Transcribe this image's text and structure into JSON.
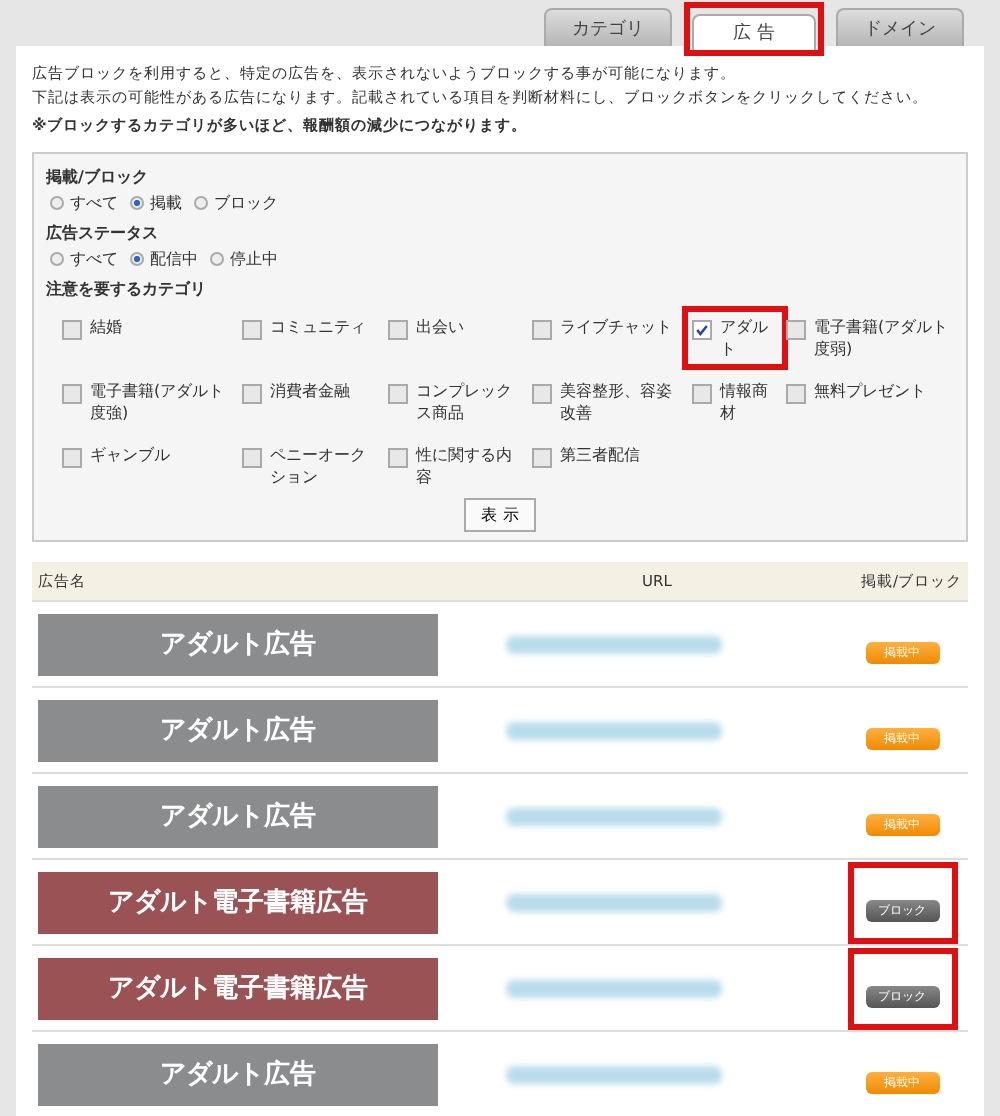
{
  "tabs": [
    {
      "label": "カテゴリ",
      "selected": false,
      "highlighted": false
    },
    {
      "label": "広 告",
      "selected": true,
      "highlighted": true
    },
    {
      "label": "ドメイン",
      "selected": false,
      "highlighted": false
    }
  ],
  "intro": [
    "広告ブロックを利用すると、特定の広告を、表示されないようブロックする事が可能になります。",
    "下記は表示の可能性がある広告になります。記載されている項目を判断材料にし、ブロックボタンをクリックしてください。"
  ],
  "notice": "※ブロックするカテゴリが多いほど、報酬額の減少につながります。",
  "filters": {
    "radio_groups": [
      {
        "label": "掲載/ブロック",
        "options": [
          {
            "label": "すべて",
            "selected": false
          },
          {
            "label": "掲載",
            "selected": true
          },
          {
            "label": "ブロック",
            "selected": false
          }
        ]
      },
      {
        "label": "広告ステータス",
        "options": [
          {
            "label": "すべて",
            "selected": false
          },
          {
            "label": "配信中",
            "selected": true
          },
          {
            "label": "停止中",
            "selected": false
          }
        ]
      }
    ],
    "category_label": "注意を要するカテゴリ",
    "categories": [
      {
        "label": "結婚",
        "checked": false,
        "highlighted": false
      },
      {
        "label": "コミュニティ",
        "checked": false,
        "highlighted": false
      },
      {
        "label": "出会い",
        "checked": false,
        "highlighted": false
      },
      {
        "label": "ライブチャット",
        "checked": false,
        "highlighted": false
      },
      {
        "label": "アダルト",
        "checked": true,
        "highlighted": true
      },
      {
        "label": "電子書籍(アダルト度弱)",
        "checked": false,
        "highlighted": false
      },
      {
        "label": "電子書籍(アダルト度強)",
        "checked": false,
        "highlighted": false
      },
      {
        "label": "消費者金融",
        "checked": false,
        "highlighted": false
      },
      {
        "label": "コンプレックス商品",
        "checked": false,
        "highlighted": false
      },
      {
        "label": "美容整形、容姿改善",
        "checked": false,
        "highlighted": false
      },
      {
        "label": "情報商材",
        "checked": false,
        "highlighted": false
      },
      {
        "label": "無料プレゼント",
        "checked": false,
        "highlighted": false
      },
      {
        "label": "ギャンブル",
        "checked": false,
        "highlighted": false
      },
      {
        "label": "ペニーオークション",
        "checked": false,
        "highlighted": false
      },
      {
        "label": "性に関する内容",
        "checked": false,
        "highlighted": false
      },
      {
        "label": "第三者配信",
        "checked": false,
        "highlighted": false
      }
    ],
    "show_button": "表 示"
  },
  "table": {
    "columns": [
      "広告名",
      "URL",
      "掲載/ブロック"
    ],
    "rows": [
      {
        "banner": "アダルト広告",
        "color": "#8a8c8e",
        "status": {
          "kind": "published",
          "label": "掲載中"
        },
        "highlighted": false
      },
      {
        "banner": "アダルト広告",
        "color": "#8a8c8e",
        "status": {
          "kind": "published",
          "label": "掲載中"
        },
        "highlighted": false
      },
      {
        "banner": "アダルト広告",
        "color": "#8a8c8e",
        "status": {
          "kind": "published",
          "label": "掲載中"
        },
        "highlighted": false
      },
      {
        "banner": "アダルト電子書籍広告",
        "color": "#9a5254",
        "status": {
          "kind": "blocked",
          "label": "ブロック"
        },
        "highlighted": true
      },
      {
        "banner": "アダルト電子書籍広告",
        "color": "#9a5254",
        "status": {
          "kind": "blocked",
          "label": "ブロック"
        },
        "highlighted": true
      },
      {
        "banner": "アダルト広告",
        "color": "#8a8c8e",
        "status": {
          "kind": "published",
          "label": "掲載中"
        },
        "highlighted": false
      }
    ]
  }
}
